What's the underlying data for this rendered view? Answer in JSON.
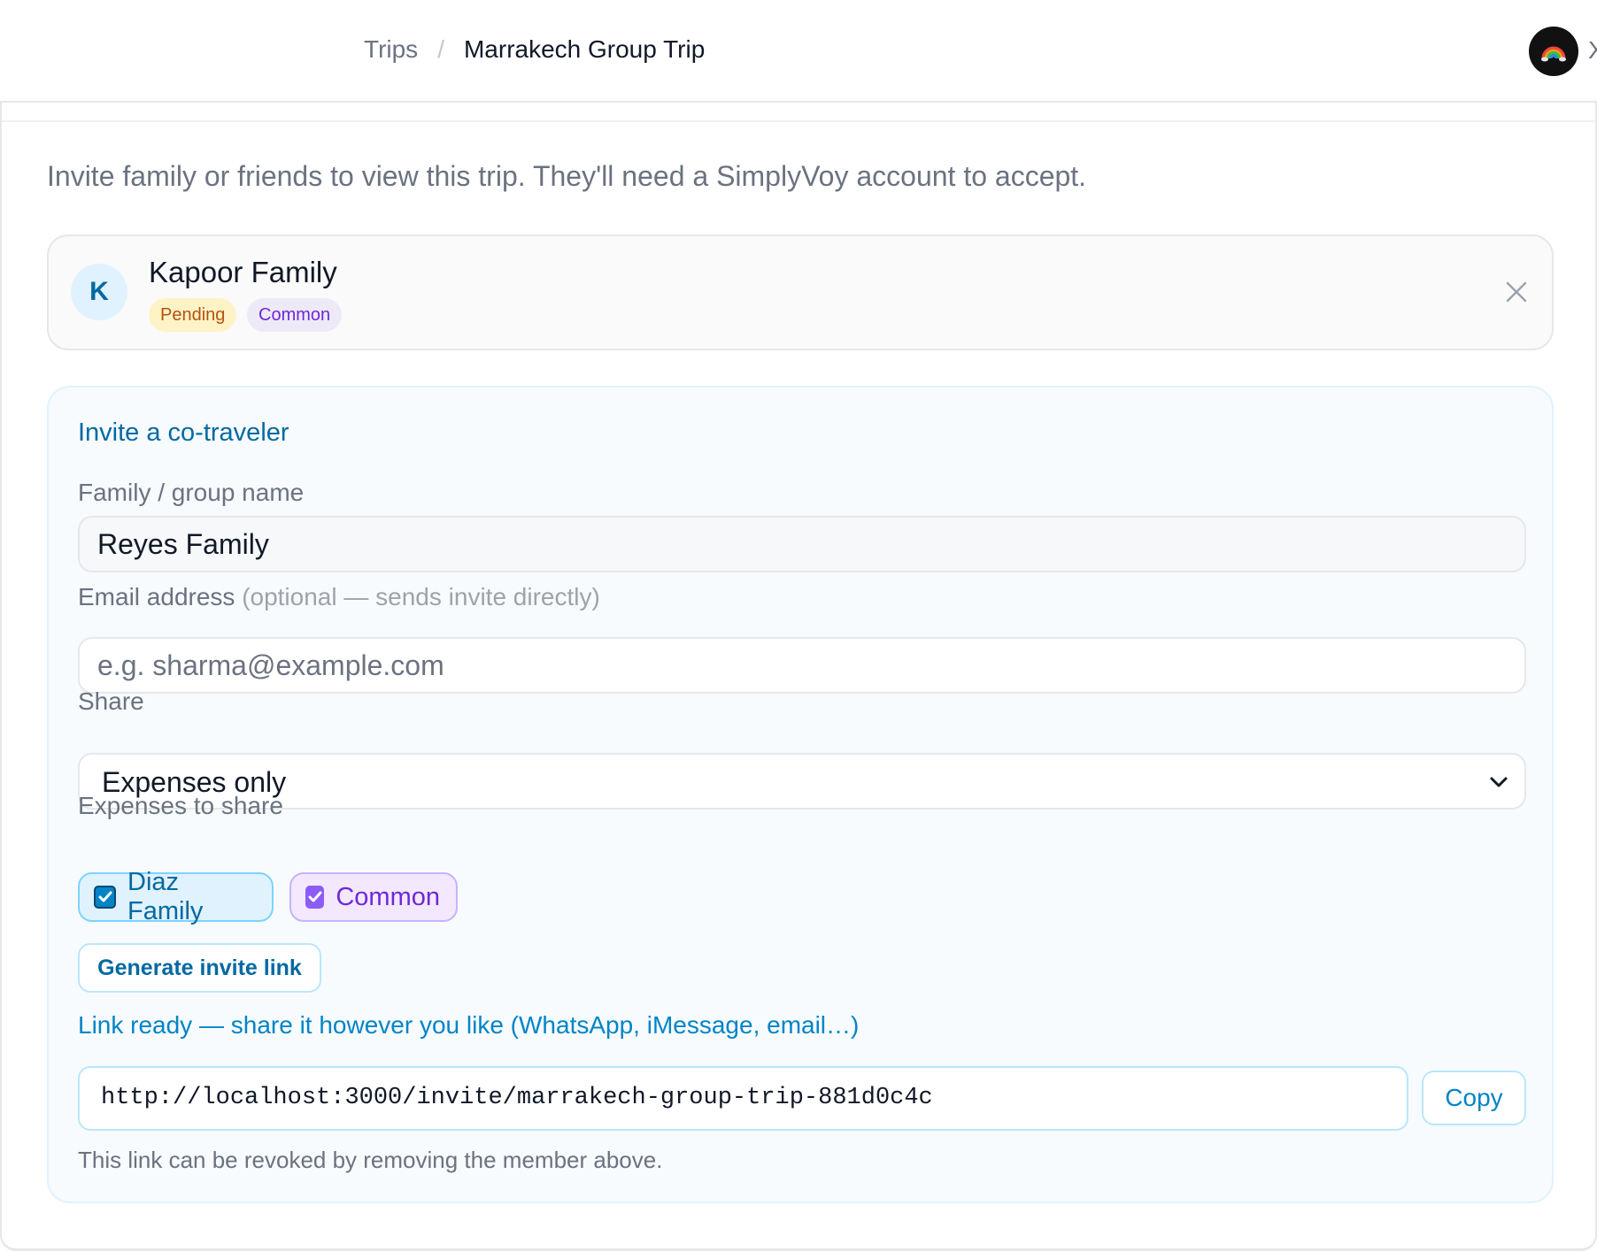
{
  "header": {
    "breadcrumb": {
      "parent": "Trips",
      "separator": "/",
      "current": "Marrakech Group Trip"
    },
    "avatar_icon": "rainbow-icon",
    "close_glyph": "X"
  },
  "panel": {
    "intro": "Invite family or friends to view this trip. They'll need a SimplyVoy account to accept."
  },
  "member": {
    "initial": "K",
    "name": "Kapoor Family",
    "badges": [
      "Pending",
      "Common"
    ],
    "remove_icon": "close-icon"
  },
  "invite": {
    "title": "Invite a co-traveler",
    "name_label": "Family / group name",
    "name_value": "Reyes Family",
    "email_label": "Email address",
    "email_hint": "(optional — sends invite directly)",
    "email_value": "",
    "email_placeholder": "e.g. sharma@example.com",
    "share_label": "Share",
    "share_value": "Expenses only",
    "expenses_label": "Expenses to share",
    "expense_options": [
      {
        "label": "Diaz Family",
        "checked": true,
        "color": "#0284c7"
      },
      {
        "label": "Common",
        "checked": true,
        "color": "#8b5cf6"
      }
    ],
    "generate_label": "Generate invite link",
    "link_ready": "Link ready — share it however you like (WhatsApp, iMessage, email…)",
    "link_url": "http://localhost:3000/invite/marrakech-group-trip-881d0c4c",
    "copy_label": "Copy",
    "revoke_note": "This link can be revoked by removing the member above."
  },
  "colors": {
    "accent": "#0369a1",
    "accent_light": "#0284c7",
    "pending_bg": "#fef3c7",
    "pending_fg": "#b45309",
    "common_bg": "#eee9f7",
    "common_fg": "#6d28d9"
  }
}
